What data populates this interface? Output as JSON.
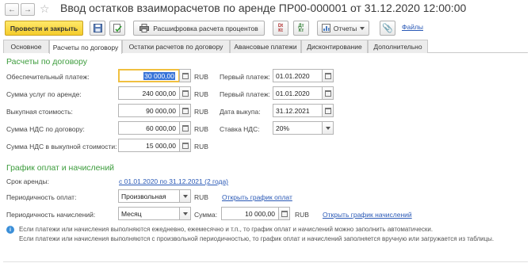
{
  "window": {
    "title": "Ввод остатков взаиморасчетов по аренде ПР00-000001 от 31.12.2020 12:00:00"
  },
  "toolbar": {
    "post_close_label": "Провести и закрыть",
    "decoding_label": "Расшифровка расчета процентов",
    "reports_label": "Отчеты",
    "files_label": "Файлы"
  },
  "tabs": [
    {
      "label": "Основное",
      "active": false
    },
    {
      "label": "Расчеты по договору",
      "active": true
    },
    {
      "label": "Остатки расчетов по договору",
      "active": false
    },
    {
      "label": "Авансовые платежи",
      "active": false
    },
    {
      "label": "Дисконтирование",
      "active": false
    },
    {
      "label": "Дополнительно",
      "active": false
    }
  ],
  "contract": {
    "section_title": "Расчеты по договору",
    "security_payment": {
      "label": "Обеспечительный платеж:",
      "value": "30 000,00",
      "unit": "RUB"
    },
    "lease_services": {
      "label": "Сумма услуг по аренде:",
      "value": "240 000,00",
      "unit": "RUB"
    },
    "buyout_cost": {
      "label": "Выкупная стоимость:",
      "value": "90 000,00",
      "unit": "RUB"
    },
    "vat_contract": {
      "label": "Сумма НДС по договору:",
      "value": "60 000,00",
      "unit": "RUB"
    },
    "vat_buyout": {
      "label": "Сумма НДС в выкупной стоимости:",
      "value": "15 000,00",
      "unit": "RUB"
    },
    "first_payment_1": {
      "label": "Первый платеж:",
      "value": "01.01.2020"
    },
    "first_payment_2": {
      "label": "Первый платеж:",
      "value": "01.01.2020"
    },
    "buyout_date": {
      "label": "Дата выкупа:",
      "value": "31.12.2021"
    },
    "vat_rate": {
      "label": "Ставка НДС:",
      "value": "20%"
    }
  },
  "schedule": {
    "section_title": "График оплат и начислений",
    "lease_term_label": "Срок аренды:",
    "lease_term_value": "с 01.01.2020 по 31.12.2021 (2 года)",
    "payment_frequency_label": "Периодичность оплат:",
    "payment_frequency_value": "Произвольная",
    "payment_unit": "RUB",
    "open_payment_schedule": "Открыть график оплат",
    "accrual_frequency_label": "Периодичность начислений:",
    "accrual_frequency_value": "Месяц",
    "sum_label": "Сумма:",
    "sum_value": "10 000,00",
    "sum_unit": "RUB",
    "open_accrual_schedule": "Открыть график начислений"
  },
  "info": {
    "line1": "Если платежи или начисления выполняются ежедневно, ежемесячно и т.п., то график оплат и начислений можно заполнить автоматически.",
    "line2": "Если платежи или начисления выполняются с произвольной периодичностью, то график оплат и начислений заполняется вручную или загружается из таблицы."
  },
  "colors": {
    "primary_button": "#f5cd2b",
    "section_header": "#3c9c3c",
    "link": "#2a59b6",
    "selection": "#3874d8",
    "info_icon": "#3b8fd8"
  }
}
